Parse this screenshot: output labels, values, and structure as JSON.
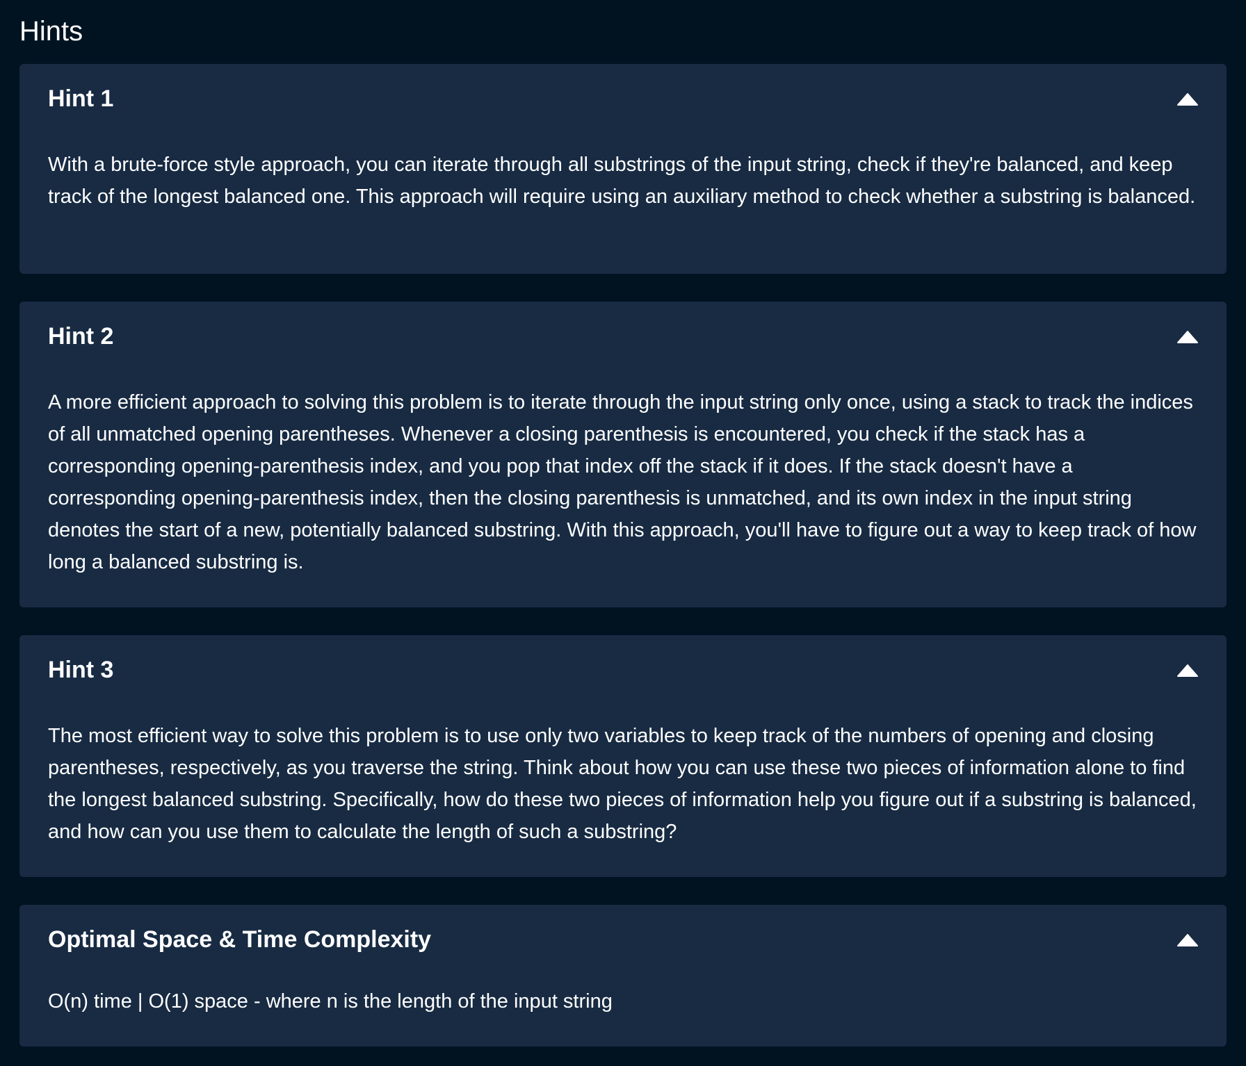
{
  "page": {
    "title": "Hints"
  },
  "panels": [
    {
      "title": "Hint 1",
      "icon": "chevron-up-icon",
      "body": "With a brute-force style approach, you can iterate through all substrings of the input string, check if they're balanced, and keep track of the longest balanced one. This approach will require using an auxiliary method to check whether a substring is balanced."
    },
    {
      "title": "Hint 2",
      "icon": "chevron-up-icon",
      "body": "A more efficient approach to solving this problem is to iterate through the input string only once, using a stack to track the indices of all unmatched opening parentheses. Whenever a closing parenthesis is encountered, you check if the stack has a corresponding opening-parenthesis index, and you pop that index off the stack if it does. If the stack doesn't have a corresponding opening-parenthesis index, then the closing parenthesis is unmatched, and its own index in the input string denotes the start of a new, potentially balanced substring. With this approach, you'll have to figure out a way to keep track of how long a balanced substring is."
    },
    {
      "title": "Hint 3",
      "icon": "chevron-up-icon",
      "body": "The most efficient way to solve this problem is to use only two variables to keep track of the numbers of opening and closing parentheses, respectively, as you traverse the string. Think about how you can use these two pieces of information alone to find the longest balanced substring. Specifically, how do these two pieces of information help you figure out if a substring is balanced, and how can you use them to calculate the length of such a substring?"
    },
    {
      "title": "Optimal Space & Time Complexity",
      "icon": "chevron-up-icon",
      "body": "O(n) time | O(1) space - where n is the length of the input string"
    }
  ],
  "colors": {
    "background": "#011321",
    "panel": "#182b43",
    "text": "#ffffff"
  }
}
